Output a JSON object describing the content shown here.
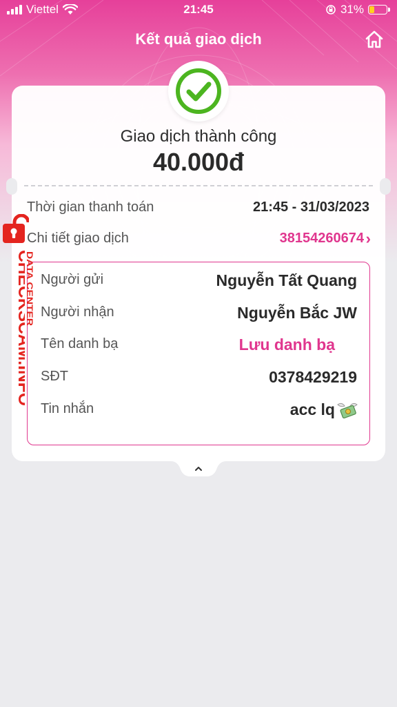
{
  "status_bar": {
    "carrier": "Viettel",
    "time": "21:45",
    "battery": "31%",
    "battery_level": 0.31
  },
  "header": {
    "title": "Kết quả giao dịch",
    "home_icon": "home-icon"
  },
  "result": {
    "status": "Giao dịch thành công",
    "amount": "40.000đ",
    "icon": "check-circle-icon",
    "accent": "#4cb520"
  },
  "details": {
    "pay_time_label": "Thời gian thanh toán",
    "pay_time_value": "21:45 - 31/03/2023",
    "detail_label": "Chi tiết giao dịch",
    "detail_value": "38154260674",
    "detail_chevron": "›"
  },
  "transfer": {
    "sender_label": "Người gửi",
    "sender_value": "Nguyễn Tất Quang",
    "receiver_label": "Người nhận",
    "receiver_value": "Nguyễn Bắc JW",
    "contact_label": "Tên danh bạ",
    "contact_value": "Lưu danh bạ",
    "phone_label": "SĐT",
    "phone_value": "0378429219",
    "message_label": "Tin nhắn",
    "message_value": "acc lq",
    "message_emoji": "money-with-wings-icon"
  },
  "watermark": {
    "text": "CHECKSCAM.INFO",
    "subtext": "DATA CENTER",
    "color": "#e4241f"
  },
  "colors": {
    "brand": "#e0368e",
    "background": "#ebebee"
  }
}
